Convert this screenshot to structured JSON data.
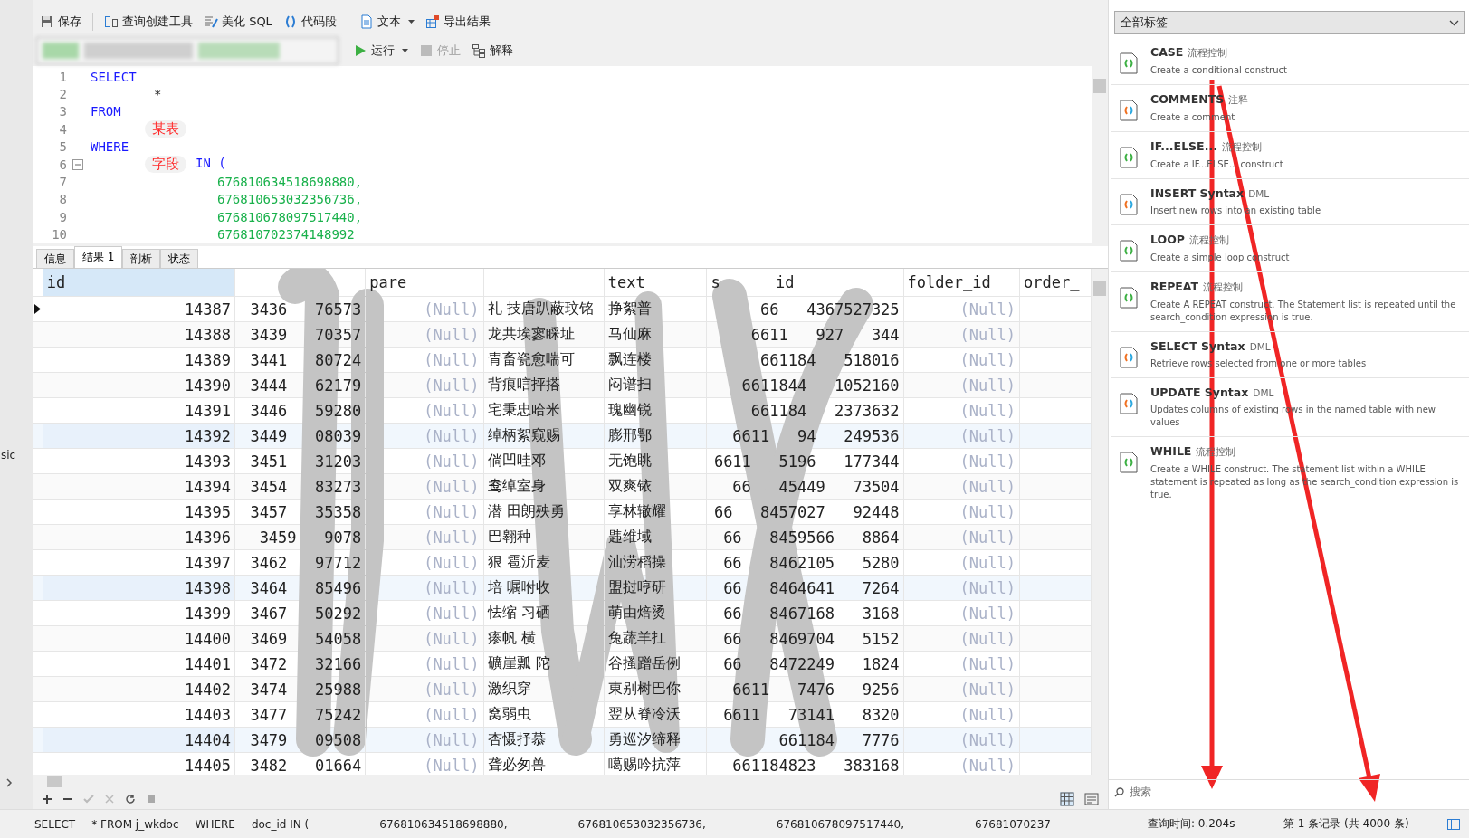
{
  "toolbar": [
    {
      "label": "保存",
      "dropdown": false
    },
    {
      "label": "查询创建工具",
      "dropdown": false
    },
    {
      "label": "美化 SQL",
      "dropdown": false
    },
    {
      "label": "代码段",
      "dropdown": false
    },
    {
      "label": "文本",
      "dropdown": true
    },
    {
      "label": "导出结果",
      "dropdown": false
    }
  ],
  "run_bar": [
    {
      "label": "运行",
      "dropdown": true,
      "disabled": false
    },
    {
      "label": "停止",
      "dropdown": false,
      "disabled": true
    },
    {
      "label": "解释",
      "dropdown": false,
      "disabled": false
    }
  ],
  "editor": {
    "lines": [
      {
        "number": "1",
        "parts": [
          {
            "kind": "keyword",
            "text": "SELECT"
          }
        ],
        "fold": false
      },
      {
        "number": "2",
        "parts": [
          {
            "kind": "indent",
            "text": "*"
          }
        ],
        "fold": false
      },
      {
        "number": "3",
        "parts": [
          {
            "kind": "keyword",
            "text": "FROM"
          }
        ],
        "fold": false
      },
      {
        "number": "4",
        "parts": [
          {
            "kind": "note",
            "text": "某表"
          }
        ],
        "fold": false
      },
      {
        "number": "5",
        "parts": [
          {
            "kind": "keyword",
            "text": "WHERE"
          }
        ],
        "fold": false
      },
      {
        "number": "6",
        "parts": [
          {
            "kind": "note",
            "text": "字段"
          },
          {
            "kind": "keyword",
            "text": "IN ("
          }
        ],
        "fold": true
      },
      {
        "number": "7",
        "parts": [
          {
            "kind": "number",
            "text": "676810634518698880,"
          }
        ],
        "fold": false
      },
      {
        "number": "8",
        "parts": [
          {
            "kind": "number",
            "text": "676810653032356736,"
          }
        ],
        "fold": false
      },
      {
        "number": "9",
        "parts": [
          {
            "kind": "number",
            "text": "676810678097517440,"
          }
        ],
        "fold": false
      },
      {
        "number": "10",
        "parts": [
          {
            "kind": "number",
            "text": "676810702374148992"
          }
        ],
        "fold": false
      }
    ]
  },
  "result_tabs": [
    {
      "label": "信息",
      "selected": false
    },
    {
      "label": "结果 1",
      "selected": true
    },
    {
      "label": "剖析",
      "selected": false
    },
    {
      "label": "状态",
      "selected": false
    }
  ],
  "table": {
    "columns": [
      {
        "label": "id",
        "selected": true
      },
      {
        "selected": false
      },
      {
        "label": "pare",
        "selected": false
      },
      {
        "selected": false
      },
      {
        "label": "text",
        "selected": false
      },
      {
        "label": "s      id",
        "selected": false
      },
      {
        "label": "folder_id",
        "selected": false
      },
      {
        "label": "order_",
        "selected": false
      }
    ],
    "rows": [
      {
        "current": true,
        "hover": false,
        "cells": [
          "14387",
          "3436   76573",
          "(Null)",
          "礼 技唐趴蔽玟铭",
          "挣絮普",
          "66   4367527325",
          "(Null)"
        ]
      },
      {
        "current": false,
        "hover": false,
        "cells": [
          "14388",
          "3439   70357",
          "(Null)",
          "龙共埃寥睬址",
          "马仙麻",
          "6611   927   344",
          "(Null)"
        ]
      },
      {
        "current": false,
        "hover": false,
        "cells": [
          "14389",
          "3441   80724",
          "(Null)",
          "青畜瓷愈喘可",
          "飘连楼",
          "661184   518016",
          "(Null)"
        ]
      },
      {
        "current": false,
        "hover": false,
        "cells": [
          "14390",
          "3444   62179",
          "(Null)",
          "背痕唁抨搭",
          "闷谱扫",
          "6611844   1052160",
          "(Null)"
        ]
      },
      {
        "current": false,
        "hover": false,
        "cells": [
          "14391",
          "3446   59280",
          "(Null)",
          "宅秉忠哈米",
          "瑰幽锐",
          "661184   2373632",
          "(Null)"
        ]
      },
      {
        "current": false,
        "hover": true,
        "cells": [
          "14392",
          "3449   08039",
          "(Null)",
          "绰柄絮窥赐",
          "膨邢鄂",
          "6611   94   249536",
          "(Null)"
        ]
      },
      {
        "current": false,
        "hover": false,
        "cells": [
          "14393",
          "3451   31203",
          "(Null)",
          "倘凹哇邓",
          "无饱眺",
          "6611   5196   177344",
          "(Null)"
        ]
      },
      {
        "current": false,
        "hover": false,
        "cells": [
          "14394",
          "3454   83273",
          "(Null)",
          "鸯绰室身",
          "双爽铱",
          "66   45449   73504",
          "(Null)"
        ]
      },
      {
        "current": false,
        "hover": false,
        "cells": [
          "14395",
          "3457   35358",
          "(Null)",
          "潜 田朗殃勇",
          "享林辙耀",
          "66   8457027   92448",
          "(Null)"
        ]
      },
      {
        "current": false,
        "hover": false,
        "cells": [
          "14396",
          "3459   9078",
          "(Null)",
          "巴翱种",
          "韪维域",
          "66   8459566   8864",
          "(Null)"
        ]
      },
      {
        "current": false,
        "hover": false,
        "cells": [
          "14397",
          "3462   97712",
          "(Null)",
          "狠 雹沂麦",
          "汕涝稻操",
          "66   8462105   5280",
          "(Null)"
        ]
      },
      {
        "current": false,
        "hover": true,
        "cells": [
          "14398",
          "3464   85496",
          "(Null)",
          "培 嘱咐收",
          "盟挝哼研",
          "66   8464641   7264",
          "(Null)"
        ]
      },
      {
        "current": false,
        "hover": false,
        "cells": [
          "14399",
          "3467   50292",
          "(Null)",
          "怯缩 习硒",
          "萌由焙烫",
          "66   8467168   3168",
          "(Null)"
        ]
      },
      {
        "current": false,
        "hover": false,
        "cells": [
          "14400",
          "3469   54058",
          "(Null)",
          "瘆帆 横",
          "兔蔬羊扛",
          "66   8469704   5152",
          "(Null)"
        ]
      },
      {
        "current": false,
        "hover": false,
        "cells": [
          "14401",
          "3472   32166",
          "(Null)",
          "礦崖瓢 陀",
          "谷搔蹭岳例",
          "66   8472249   1824",
          "(Null)"
        ]
      },
      {
        "current": false,
        "hover": false,
        "cells": [
          "14402",
          "3474   25988",
          "(Null)",
          "激织穿",
          "東别树巴你",
          "6611   7476   9256",
          "(Null)"
        ]
      },
      {
        "current": false,
        "hover": false,
        "cells": [
          "14403",
          "3477   75242",
          "(Null)",
          "窝弱虫",
          "翌从脊冷沃",
          "6611   73141   8320",
          "(Null)"
        ]
      },
      {
        "current": false,
        "hover": true,
        "cells": [
          "14404",
          "3479   09508",
          "(Null)",
          "杏慑抒慕",
          "勇巡汐缔释",
          "661184   7776",
          "(Null)"
        ]
      },
      {
        "current": false,
        "hover": false,
        "cells": [
          "14405",
          "3482   01664",
          "(Null)",
          "聋必匆兽",
          "噶赐吟抗萍",
          "661184823   383168",
          "(Null)"
        ]
      }
    ]
  },
  "status_bar": {
    "sql": [
      "SELECT",
      "* FROM j_wkdoc",
      "WHERE",
      "doc_id IN (",
      "676810634518698880,",
      "676810653032356736,",
      "676810678097517440,",
      "67681070237"
    ],
    "query_time": "查询时间: 0.204s",
    "record": "第 1 条记录 (共 4000 条)"
  },
  "side_strip": {
    "text": "sic"
  },
  "snippets": {
    "filter": "全部标签",
    "search_placeholder": "搜索",
    "items": [
      {
        "title": "CASE",
        "tag": "流程控制",
        "kind": "flow",
        "desc": "Create a conditional construct"
      },
      {
        "title": "COMMENTS",
        "tag": "注释",
        "kind": "dml",
        "desc": "Create a comment"
      },
      {
        "title": "IF...ELSE...",
        "tag": "流程控制",
        "kind": "flow",
        "desc": "Create a IF...ELSE... construct"
      },
      {
        "title": "INSERT Syntax",
        "tag": "DML",
        "kind": "dml",
        "desc": "Insert new rows into an existing table"
      },
      {
        "title": "LOOP",
        "tag": "流程控制",
        "kind": "flow",
        "desc": "Create a simple loop construct"
      },
      {
        "title": "REPEAT",
        "tag": "流程控制",
        "kind": "flow",
        "desc": "Create A REPEAT construct. The Statement list is repeated until the search_condition expression is true."
      },
      {
        "title": "SELECT Syntax",
        "tag": "DML",
        "kind": "dml",
        "desc": "Retrieve rows selected from one or more tables"
      },
      {
        "title": "UPDATE Syntax",
        "tag": "DML",
        "kind": "dml",
        "desc": "Updates columns of existing rows in the named table with new values"
      },
      {
        "title": "WHILE",
        "tag": "流程控制",
        "kind": "flow",
        "desc": "Create a WHILE construct. The statement list within a WHILE statement is repeated as long as the search_condition expression is true."
      }
    ]
  }
}
